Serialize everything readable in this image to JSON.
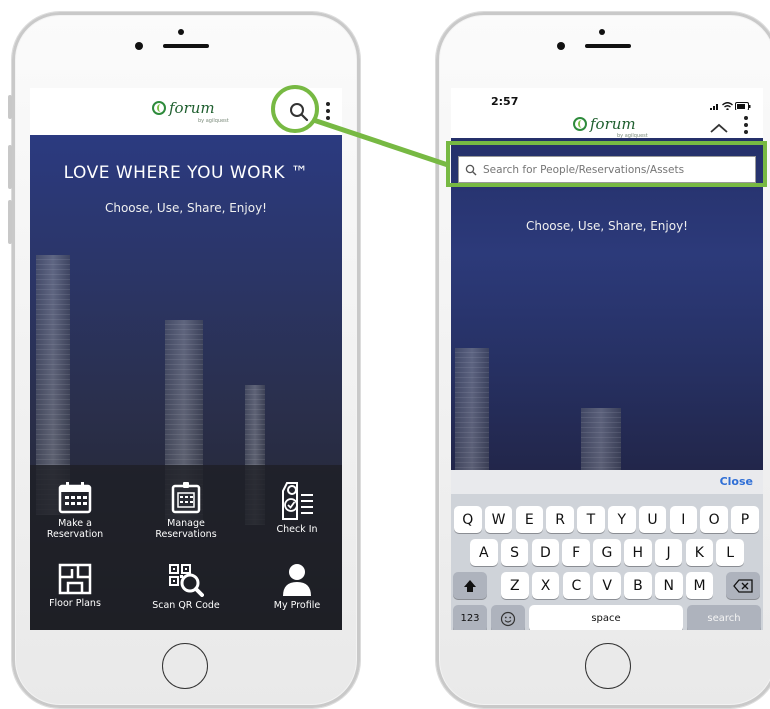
{
  "left_phone": {
    "logo_text": "forum",
    "logo_sub": "by agilquest",
    "hero_title": "LOVE WHERE YOU WORK ™",
    "hero_subtitle": "Choose, Use, Share, Enjoy!",
    "tiles": [
      {
        "label_line1": "Make a",
        "label_line2": "Reservation",
        "icon": "calendar-icon"
      },
      {
        "label_line1": "Manage",
        "label_line2": "Reservations",
        "icon": "calendar-manage-icon"
      },
      {
        "label_line1": "Check In",
        "label_line2": "",
        "icon": "door-hanger-icon"
      },
      {
        "label_line1": "Floor Plans",
        "label_line2": "",
        "icon": "floor-plan-icon"
      },
      {
        "label_line1": "Scan QR Code",
        "label_line2": "",
        "icon": "qr-scan-icon"
      },
      {
        "label_line1": "My Profile",
        "label_line2": "",
        "icon": "profile-icon"
      }
    ]
  },
  "right_phone": {
    "status_time": "2:57",
    "logo_text": "forum",
    "logo_sub": "by agilquest",
    "search_placeholder": "Search for People/Reservations/Assets",
    "hero_subtitle": "Choose, Use, Share, Enjoy!",
    "keyboard": {
      "close_label": "Close",
      "row1": [
        "Q",
        "W",
        "E",
        "R",
        "T",
        "Y",
        "U",
        "I",
        "O",
        "P"
      ],
      "row2": [
        "A",
        "S",
        "D",
        "F",
        "G",
        "H",
        "J",
        "K",
        "L"
      ],
      "row3": [
        "Z",
        "X",
        "C",
        "V",
        "B",
        "N",
        "M"
      ],
      "numbers_key": "123",
      "space_key": "space",
      "search_key": "search"
    }
  },
  "colors": {
    "highlight": "#77b943",
    "hero_top": "#2b3a80",
    "keyboard_bg": "#cfd3d9",
    "close_blue": "#2f6fd6"
  }
}
